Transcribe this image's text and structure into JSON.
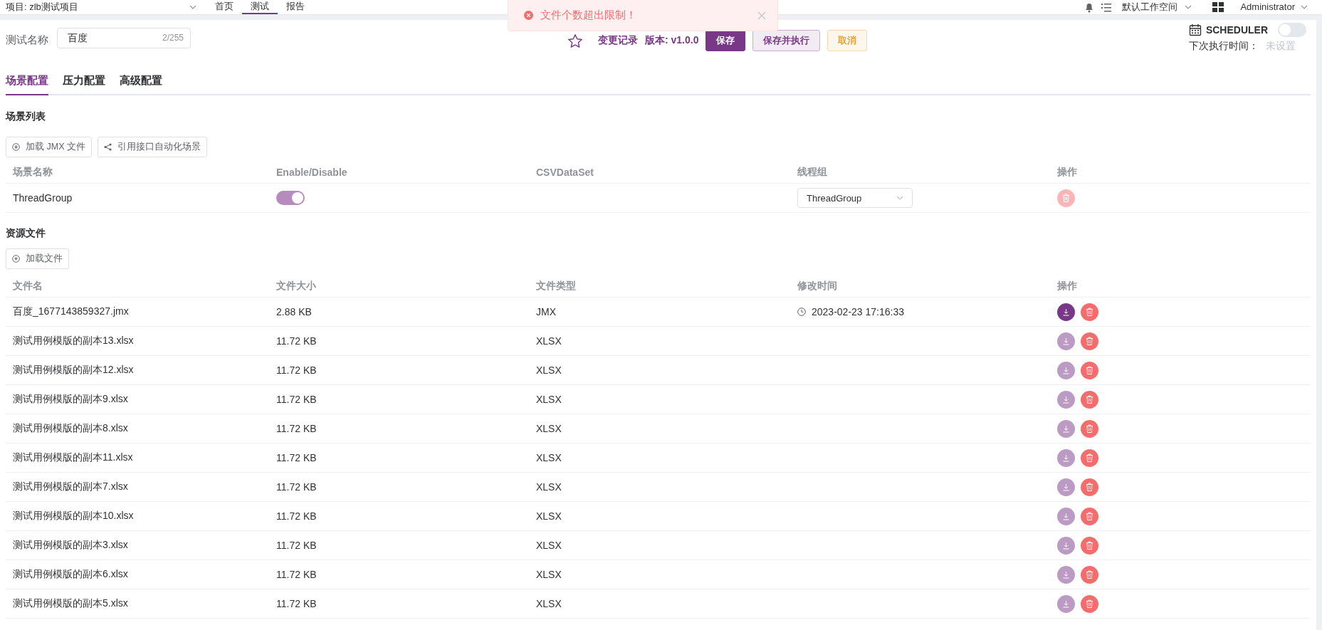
{
  "top_bar": {
    "project": "项目: zlb测试项目",
    "nav": [
      {
        "label": "首页",
        "selected": false
      },
      {
        "label": "测试",
        "selected": true
      },
      {
        "label": "报告",
        "selected": false
      }
    ],
    "workspace": "默认工作空间",
    "user": "Administrator"
  },
  "toast": {
    "kind": "error",
    "message": "文件个数超出限制！"
  },
  "test_name": {
    "label": "测试名称",
    "value": "百度",
    "count": "2/255"
  },
  "header_actions": {
    "history_link": "变更记录",
    "version": "版本: v1.0.0",
    "buttons": [
      {
        "label": "保存",
        "kind": "primary"
      },
      {
        "label": "保存并执行",
        "kind": "plain"
      },
      {
        "label": "取消",
        "kind": "warning"
      }
    ]
  },
  "scheduler": {
    "title": "SCHEDULER",
    "on": false,
    "next_run_label": "下次执行时间：",
    "next_run_value": "未设置"
  },
  "tabs": [
    {
      "label": "场景配置",
      "selected": true
    },
    {
      "label": "压力配置",
      "selected": false
    },
    {
      "label": "高级配置",
      "selected": false
    }
  ],
  "scenario_list": {
    "title": "场景列表",
    "buttons": [
      {
        "label": "加载 JMX 文件",
        "kind": "upload"
      },
      {
        "label": "引用接口自动化场景",
        "kind": "share"
      }
    ],
    "columns": [
      "场景名称",
      "Enable/Disable",
      "CSVDataSet",
      "线程组",
      "操作"
    ],
    "rows": [
      {
        "name": "ThreadGroup",
        "enabled": true,
        "thread_group": "ThreadGroup",
        "delete_disabled": true
      }
    ]
  },
  "resource_files": {
    "title": "资源文件",
    "upload_button": "加载文件",
    "columns": [
      "文件名",
      "文件大小",
      "文件类型",
      "修改时间",
      "操作"
    ],
    "rows": [
      {
        "name": "百度_1677143859327.jmx",
        "size": "2.88 KB",
        "type": "JMX",
        "modified": "2023-02-23 17:16:33",
        "download_disabled": false
      },
      {
        "name": "测试用例模版的副本13.xlsx",
        "size": "11.72 KB",
        "type": "XLSX",
        "download_disabled": true
      },
      {
        "name": "测试用例模版的副本12.xlsx",
        "size": "11.72 KB",
        "type": "XLSX",
        "download_disabled": true
      },
      {
        "name": "测试用例模版的副本9.xlsx",
        "size": "11.72 KB",
        "type": "XLSX",
        "download_disabled": true
      },
      {
        "name": "测试用例模版的副本8.xlsx",
        "size": "11.72 KB",
        "type": "XLSX",
        "download_disabled": true
      },
      {
        "name": "测试用例模版的副本11.xlsx",
        "size": "11.72 KB",
        "type": "XLSX",
        "download_disabled": true
      },
      {
        "name": "测试用例模版的副本7.xlsx",
        "size": "11.72 KB",
        "type": "XLSX",
        "download_disabled": true
      },
      {
        "name": "测试用例模版的副本10.xlsx",
        "size": "11.72 KB",
        "type": "XLSX",
        "download_disabled": true
      },
      {
        "name": "测试用例模版的副本3.xlsx",
        "size": "11.72 KB",
        "type": "XLSX",
        "download_disabled": true
      },
      {
        "name": "测试用例模版的副本6.xlsx",
        "size": "11.72 KB",
        "type": "XLSX",
        "download_disabled": true
      },
      {
        "name": "测试用例模版的副本5.xlsx",
        "size": "11.72 KB",
        "type": "XLSX",
        "download_disabled": true
      }
    ]
  }
}
